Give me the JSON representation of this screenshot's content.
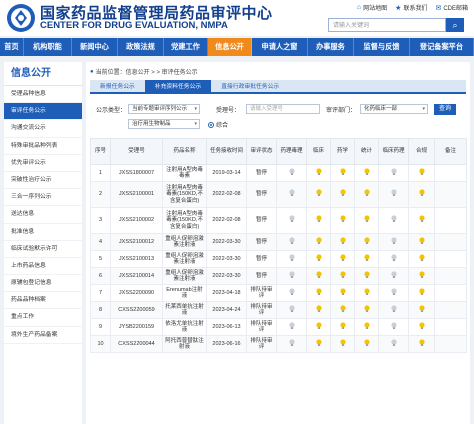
{
  "header": {
    "title": "国家药品监督管理局药品审评中心",
    "subtitle": "CENTER FOR DRUG EVALUATION, NMPA",
    "links": [
      {
        "icon": "home-icon",
        "label": "网站地图"
      },
      {
        "icon": "star-icon",
        "label": "联系我们"
      },
      {
        "icon": "mail-icon",
        "label": "CDE邮箱"
      }
    ],
    "search_placeholder": "请输入关键词"
  },
  "nav": {
    "items": [
      {
        "label": "首页",
        "active": false
      },
      {
        "label": "机构职能",
        "active": false
      },
      {
        "label": "新闻中心",
        "active": false
      },
      {
        "label": "政策法规",
        "active": false
      },
      {
        "label": "党建工作",
        "active": false
      },
      {
        "label": "信息公开",
        "active": true
      },
      {
        "label": "申请人之窗",
        "active": false
      },
      {
        "label": "办事服务",
        "active": false
      },
      {
        "label": "监督与反馈",
        "active": false
      },
      {
        "label": "登记备案平台",
        "active": false
      }
    ]
  },
  "sidebar": {
    "title": "信息公开",
    "items": [
      {
        "label": "受理品种信息",
        "active": false
      },
      {
        "label": "审评任务公示",
        "active": true
      },
      {
        "label": "沟通交流公示",
        "active": false
      },
      {
        "label": "特殊审批品种列表",
        "active": false
      },
      {
        "label": "优先审评公示",
        "active": false
      },
      {
        "label": "突破性治疗公示",
        "active": false
      },
      {
        "label": "三合一序列公示",
        "active": false
      },
      {
        "label": "送达信息",
        "active": false
      },
      {
        "label": "批准信息",
        "active": false
      },
      {
        "label": "临床试验默示许可",
        "active": false
      },
      {
        "label": "上市药品信息",
        "active": false
      },
      {
        "label": "原辅包登记信息",
        "active": false
      },
      {
        "label": "药品品种档案",
        "active": false
      },
      {
        "label": "重点工作",
        "active": false
      },
      {
        "label": "境外生产药品备案",
        "active": false
      }
    ]
  },
  "breadcrumb": {
    "text": "当前位置：信息公开 > > 审评任务公示"
  },
  "tabs": [
    {
      "label": "新报任务公示",
      "active": false
    },
    {
      "label": "补充资料任务公示",
      "active": true
    },
    {
      "label": "直接行政审批任务公示",
      "active": false
    }
  ],
  "filters": {
    "type_label": "公示类型：",
    "type_value": "当前专题审评序列公示",
    "accept_label": "受理号：",
    "accept_placeholder": "请输入受理号",
    "review_label": "审评部门：",
    "review_value": "化药临床一部",
    "category_value": "治疗用生物制品",
    "radio_label": "综合",
    "query_label": "查询"
  },
  "table": {
    "headers": [
      "序号",
      "受理号",
      "药品名称",
      "任务接收时间",
      "审评状态",
      "药理毒理",
      "临床",
      "药学",
      "统计",
      "临床药理",
      "合规",
      "备注"
    ],
    "rows": [
      {
        "no": "1",
        "accept": "JXSS1800007",
        "name": "注射用A型肉毒毒素",
        "date": "2019-03-14",
        "status": "暂停",
        "bulbs": [
          false,
          true,
          true,
          true,
          false,
          true,
          false
        ]
      },
      {
        "no": "2",
        "accept": "JXSS2100001",
        "name": "注射用A型肉毒毒素(150KD,不含复合蛋白)",
        "date": "2022-02-08",
        "status": "暂停",
        "bulbs": [
          false,
          true,
          true,
          true,
          false,
          true,
          false
        ]
      },
      {
        "no": "3",
        "accept": "JXSS2100002",
        "name": "注射用A型肉毒毒素(150KD,不含复合蛋白)",
        "date": "2022-02-08",
        "status": "暂停",
        "bulbs": [
          false,
          true,
          true,
          true,
          false,
          true,
          false
        ]
      },
      {
        "no": "4",
        "accept": "JXSS2100012",
        "name": "重组人促卵泡激素注射液",
        "date": "2022-03-30",
        "status": "暂停",
        "bulbs": [
          false,
          true,
          true,
          true,
          false,
          true,
          false
        ]
      },
      {
        "no": "5",
        "accept": "JXSS2100013",
        "name": "重组人促卵泡激素注射液",
        "date": "2022-03-30",
        "status": "暂停",
        "bulbs": [
          false,
          true,
          true,
          true,
          false,
          true,
          false
        ]
      },
      {
        "no": "6",
        "accept": "JXSS2100014",
        "name": "重组人促卵泡激素注射液",
        "date": "2022-03-30",
        "status": "暂停",
        "bulbs": [
          false,
          true,
          true,
          true,
          false,
          true,
          false
        ]
      },
      {
        "no": "7",
        "accept": "JXSS2200090",
        "name": "Erenumab注射液",
        "date": "2023-04-18",
        "status": "排队待审评",
        "bulbs": [
          false,
          true,
          true,
          true,
          false,
          true,
          false
        ]
      },
      {
        "no": "8",
        "accept": "CXSS2200059",
        "name": "托莱西单抗注射液",
        "date": "2023-04-24",
        "status": "排队待审评",
        "bulbs": [
          false,
          true,
          true,
          true,
          false,
          true,
          false
        ]
      },
      {
        "no": "9",
        "accept": "JYSB2200159",
        "name": "依洛尤单抗注射液",
        "date": "2023-06-13",
        "status": "排队待审评",
        "bulbs": [
          false,
          true,
          true,
          true,
          false,
          true,
          false
        ]
      },
      {
        "no": "10",
        "accept": "CXSS2200044",
        "name": "阿托西普替肽注射液",
        "date": "2023-06-16",
        "status": "排队待审评",
        "bulbs": [
          false,
          true,
          true,
          true,
          false,
          true,
          false
        ]
      }
    ]
  },
  "colors": {
    "brand_blue": "#1e5db8",
    "nav_active": "#f08a1c",
    "bulb_on": "#f5c400",
    "bulb_off": "#c9cfd8"
  }
}
